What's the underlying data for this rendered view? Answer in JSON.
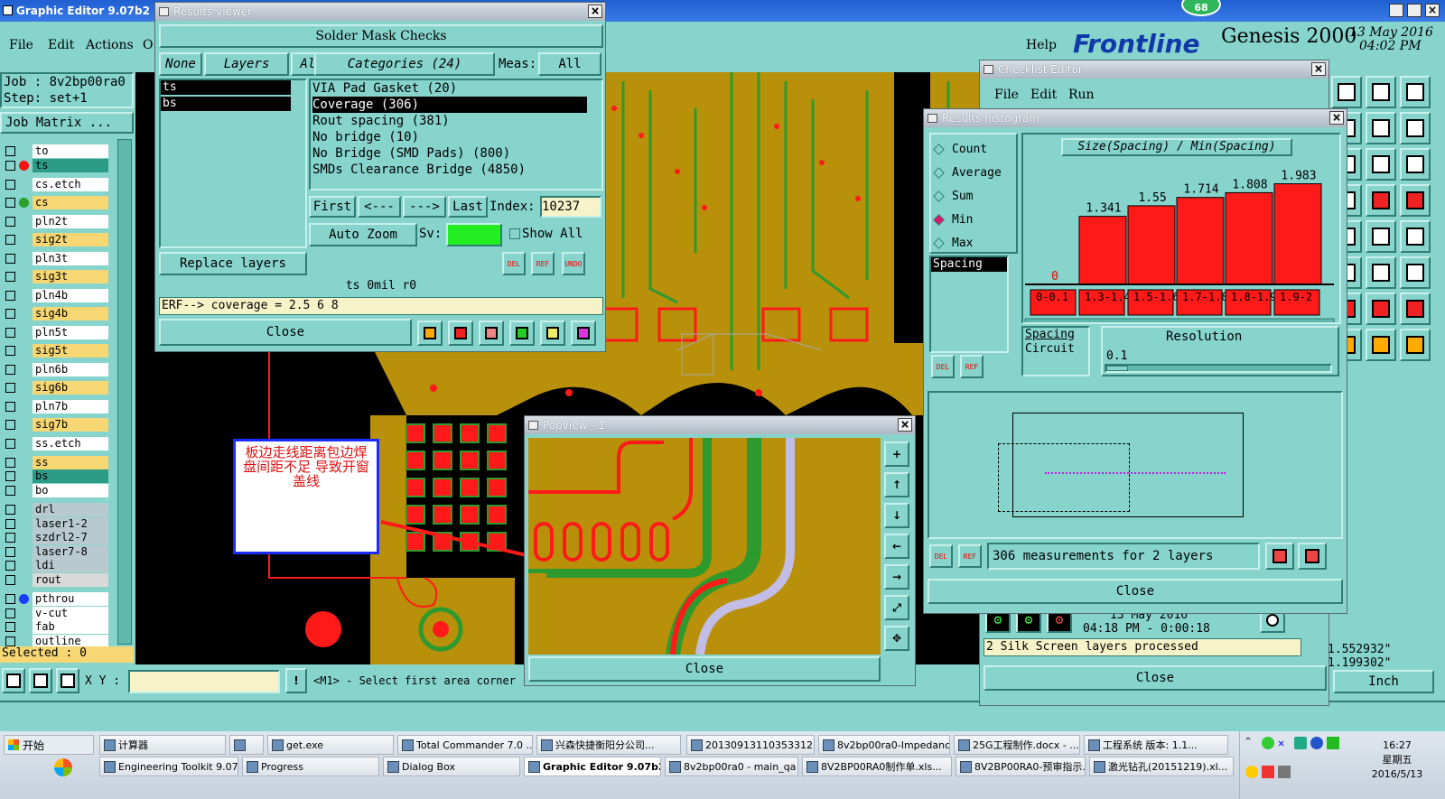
{
  "main": {
    "title": "Graphic Editor 9.07b2 (00@",
    "menu": [
      "File",
      "Edit",
      "Actions",
      "O"
    ],
    "help": "Help",
    "brand": "Frontline",
    "product": "Genesis 2000",
    "date": "13 May 2016",
    "time": "04:02 PM",
    "badge": "68",
    "job_label": "Job : 8v2bp00ra0",
    "step_label": "Step: set+1",
    "job_matrix": "Job Matrix ...",
    "selected": "Selected : 0",
    "xy_label": "X Y :",
    "xy_value": "",
    "status_msg": "<M1> - Select first area corner",
    "coord_x": "1.552932\"",
    "coord_y": "1.199302\"",
    "units": "Inch"
  },
  "layers": [
    {
      "name": "to",
      "color": "#ffffff",
      "dot": ""
    },
    {
      "name": "ts",
      "color": "#2d9c86",
      "dot": "#ff1010"
    },
    {
      "name": "cs.etch",
      "color": "#ffffff",
      "dot": ""
    },
    {
      "name": "cs",
      "color": "#f7d774",
      "dot": "#2aa02a"
    },
    {
      "name": "pln2t",
      "color": "#ffffff",
      "dot": ""
    },
    {
      "name": "sig2t",
      "color": "#f7d774",
      "dot": ""
    },
    {
      "name": "pln3t",
      "color": "#ffffff",
      "dot": ""
    },
    {
      "name": "sig3t",
      "color": "#f7d774",
      "dot": ""
    },
    {
      "name": "pln4b",
      "color": "#ffffff",
      "dot": ""
    },
    {
      "name": "sig4b",
      "color": "#f7d774",
      "dot": ""
    },
    {
      "name": "pln5t",
      "color": "#ffffff",
      "dot": ""
    },
    {
      "name": "sig5t",
      "color": "#f7d774",
      "dot": ""
    },
    {
      "name": "pln6b",
      "color": "#ffffff",
      "dot": ""
    },
    {
      "name": "sig6b",
      "color": "#f7d774",
      "dot": ""
    },
    {
      "name": "pln7b",
      "color": "#ffffff",
      "dot": ""
    },
    {
      "name": "sig7b",
      "color": "#f7d774",
      "dot": ""
    },
    {
      "name": "ss.etch",
      "color": "#ffffff",
      "dot": ""
    },
    {
      "name": "ss",
      "color": "#f7d774",
      "dot": ""
    },
    {
      "name": "bs",
      "color": "#2d9c86",
      "dot": ""
    },
    {
      "name": "bo",
      "color": "#ffffff",
      "dot": ""
    },
    {
      "name": "drl",
      "color": "#b9c9d0",
      "dot": ""
    },
    {
      "name": "laser1-2",
      "color": "#b9c9d0",
      "dot": ""
    },
    {
      "name": "szdrl2-7",
      "color": "#b9c9d0",
      "dot": ""
    },
    {
      "name": "laser7-8",
      "color": "#b9c9d0",
      "dot": ""
    },
    {
      "name": "ldi",
      "color": "#b9c9d0",
      "dot": ""
    },
    {
      "name": "rout",
      "color": "#d9d9d9",
      "dot": ""
    },
    {
      "name": "pthrou",
      "color": "#ffffff",
      "dot": "#1a3cff"
    },
    {
      "name": "v-cut",
      "color": "#ffffff",
      "dot": ""
    },
    {
      "name": "fab",
      "color": "#ffffff",
      "dot": ""
    },
    {
      "name": "outline",
      "color": "#ffffff",
      "dot": ""
    }
  ],
  "results_viewer": {
    "title": "Results viewer",
    "header": "Solder Mask Checks",
    "none": "None",
    "layers_label": "Layers",
    "all": "All",
    "categories_label": "Categories (24)",
    "meas_label": "Meas:",
    "meas_value": "All",
    "layer_items": [
      "ts",
      "bs"
    ],
    "categories": [
      "VIA Pad Gasket (20)",
      "Coverage (306)",
      "Rout spacing (381)",
      "No bridge (10)",
      "No Bridge (SMD Pads) (800)",
      "SMDs Clearance Bridge (4850)"
    ],
    "first": "First",
    "prev": "<---",
    "next": "--->",
    "last": "Last",
    "index_label": "Index:",
    "index_value": "10237",
    "auto_zoom": "Auto Zoom",
    "sv_label": "Sv:",
    "show_all": "Show All",
    "replace_layers": "Replace layers",
    "del": "DEL",
    "ref": "REF",
    "undo": "UNDO",
    "info": "ts 0mil r0",
    "erf": "ERF--> coverage = 2.5 6 8",
    "close": "Close"
  },
  "checklist": {
    "title": "Checklist Editor",
    "menu": [
      "File",
      "Edit",
      "Run"
    ],
    "date": "13 May 2016",
    "time": "04:18 PM - 0:00:18",
    "status": "2 Silk Screen layers processed",
    "close": "Close"
  },
  "histogram": {
    "title": "Results histogram",
    "options": [
      {
        "label": "Count",
        "selected": false
      },
      {
        "label": "Average",
        "selected": false
      },
      {
        "label": "Sum",
        "selected": false
      },
      {
        "label": "Min",
        "selected": true
      },
      {
        "label": "Max",
        "selected": false
      }
    ],
    "formula": "Size(Spacing) / Min(Spacing)",
    "left_list": [
      "Spacing"
    ],
    "bottom_list": [
      "Spacing",
      "Circuit"
    ],
    "resolution_label": "Resolution",
    "resolution_value": "0.1",
    "del": "DEL",
    "ref": "REF",
    "measurements": "306 measurements for 2 layers",
    "close": "Close"
  },
  "chart_data": {
    "type": "bar",
    "categories": [
      "0-0.1",
      "1.3-1.4",
      "1.5-1.6",
      "1.7-1.8",
      "1.8-1.9",
      "1.9-2"
    ],
    "values": [
      0,
      1.341,
      1.55,
      1.714,
      1.808,
      1.983
    ],
    "ylim": [
      0,
      2.1
    ],
    "title": "Size(Spacing) / Min(Spacing)"
  },
  "popview": {
    "title": "Popview - 1",
    "close": "Close"
  },
  "annotation": {
    "text": "板边走线距离包边焊盘间距不足 导致开窗盖线"
  },
  "taskbar": {
    "start": "开始",
    "row1": [
      "计算器",
      "",
      "get.exe",
      "Total Commander 7.0 ...",
      "兴森快捷衡阳分公司...",
      "20130913110353312.r...",
      "8v2bp00ra0-Impedanc...",
      "25G工程制作.docx - ...",
      "工程系统 版本: 1.1..."
    ],
    "row2": [
      "Engineering Toolkit 9.07...",
      "Progress",
      "Dialog Box",
      "Graphic Editor 9.07b2...",
      "8v2bp00ra0 - main_qa",
      "8V2BP00RA0制作单.xls...",
      "8V2BP00RA0-预审指示...",
      "激光钻孔(20151219).xl..."
    ],
    "clock": "16:27",
    "weekday": "星期五",
    "date": "2016/5/13"
  },
  "colors": {
    "teal": "#86d4cc",
    "board_gold": "#b8900a",
    "mask_green": "#2e9a2e",
    "pad_red": "#ff1010"
  }
}
